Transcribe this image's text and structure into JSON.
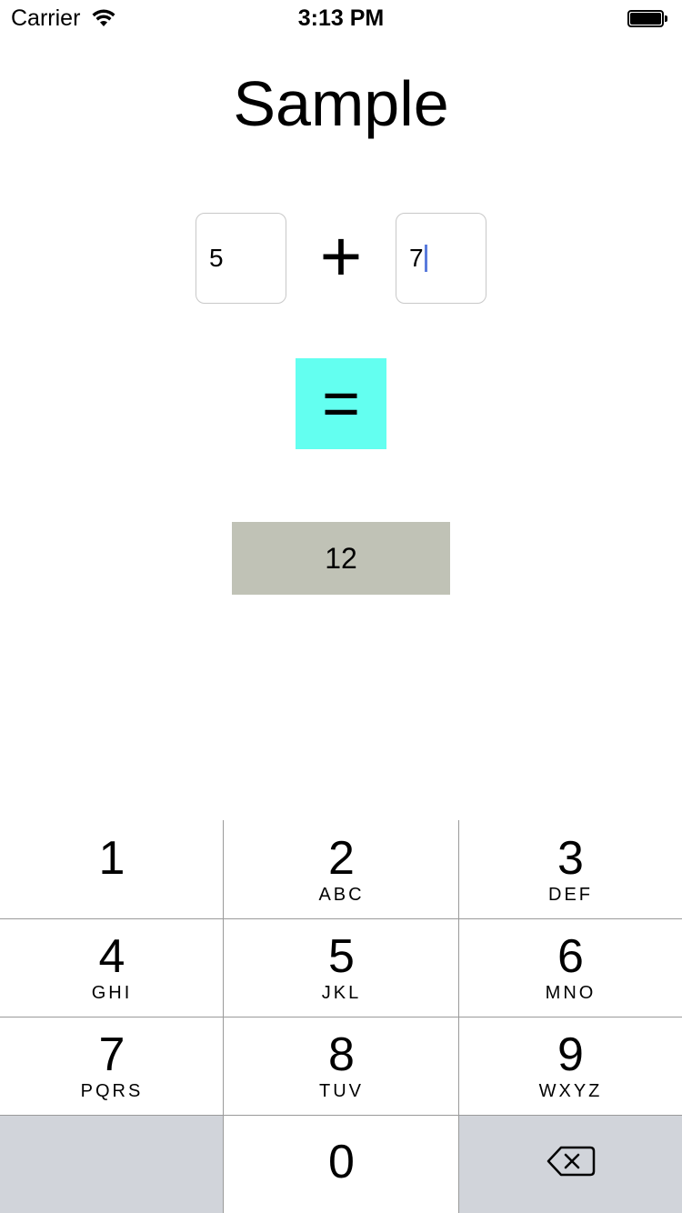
{
  "status_bar": {
    "carrier": "Carrier",
    "time": "3:13 PM"
  },
  "title": "Sample",
  "calculator": {
    "operand_a": "5",
    "operator": "+",
    "operand_b": "7",
    "equals_label": "=",
    "result": "12",
    "equals_color": "#63fff0",
    "result_color": "#c0c2b6"
  },
  "keypad": {
    "keys": [
      {
        "digit": "1",
        "letters": ""
      },
      {
        "digit": "2",
        "letters": "ABC"
      },
      {
        "digit": "3",
        "letters": "DEF"
      },
      {
        "digit": "4",
        "letters": "GHI"
      },
      {
        "digit": "5",
        "letters": "JKL"
      },
      {
        "digit": "6",
        "letters": "MNO"
      },
      {
        "digit": "7",
        "letters": "PQRS"
      },
      {
        "digit": "8",
        "letters": "TUV"
      },
      {
        "digit": "9",
        "letters": "WXYZ"
      },
      {
        "digit": "0",
        "letters": ""
      }
    ],
    "delete_icon": "backspace-icon",
    "gray_color": "#d1d4da"
  }
}
